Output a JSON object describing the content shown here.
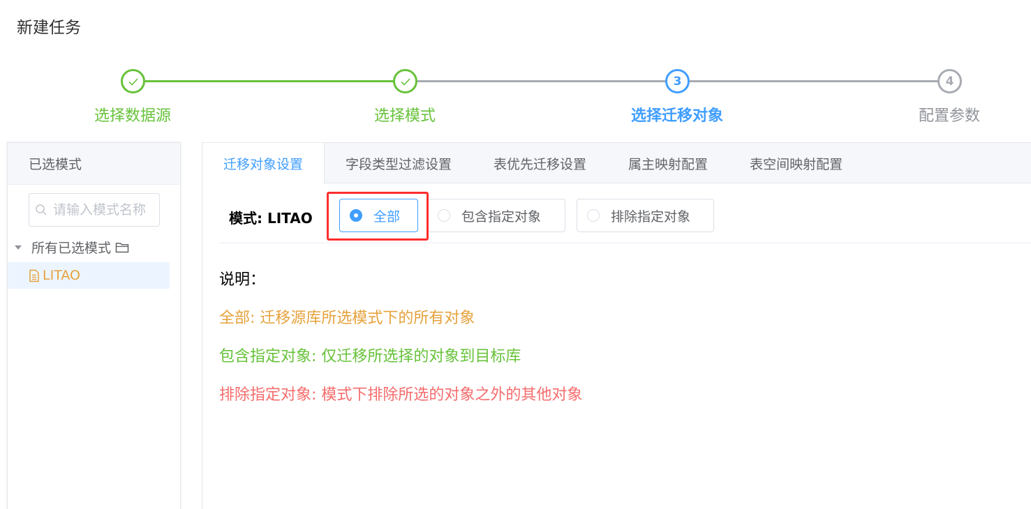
{
  "page": {
    "title": "新建任务"
  },
  "steps": [
    {
      "number": "1",
      "title": "选择数据源",
      "status": "done"
    },
    {
      "number": "2",
      "title": "选择模式",
      "status": "done"
    },
    {
      "number": "3",
      "title": "选择迁移对象",
      "status": "active"
    },
    {
      "number": "4",
      "title": "配置参数",
      "status": "pending"
    }
  ],
  "left_panel": {
    "header": "已选模式",
    "search_placeholder": "请输入模式名称",
    "tree": {
      "root_label": "所有已选模式",
      "children": [
        {
          "label": "LITAO"
        }
      ]
    }
  },
  "tabs": [
    {
      "label": "迁移对象设置",
      "active": true
    },
    {
      "label": "字段类型过滤设置",
      "active": false
    },
    {
      "label": "表优先迁移设置",
      "active": false
    },
    {
      "label": "属主映射配置",
      "active": false
    },
    {
      "label": "表空间映射配置",
      "active": false
    }
  ],
  "mode": {
    "label": "模式: LITAO",
    "options": [
      {
        "label": "全部",
        "checked": true
      },
      {
        "label": "包含指定对象",
        "checked": false
      },
      {
        "label": "排除指定对象",
        "checked": false
      }
    ]
  },
  "description": {
    "heading": "说明：",
    "lines": [
      {
        "text": "全部: 迁移源库所选模式下的所有对象",
        "color": "#e6a23c"
      },
      {
        "text": "包含指定对象: 仅迁移所选择的对象到目标库",
        "color": "#67c23a"
      },
      {
        "text": "排除指定对象: 模式下排除所选的对象之外的其他对象",
        "color": "#f56c6c"
      }
    ]
  },
  "colors": {
    "success": "#67c23a",
    "primary": "#409eff",
    "warning": "#e6a23c",
    "danger": "#f56c6c",
    "highlight": "#ff2d2d"
  }
}
